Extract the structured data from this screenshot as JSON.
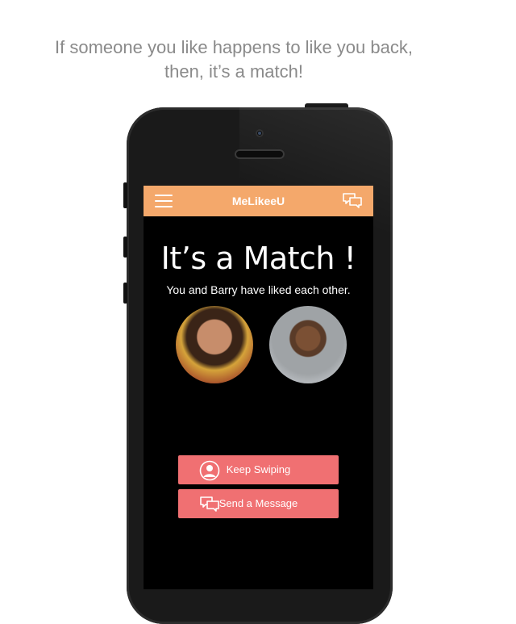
{
  "caption": {
    "line1": "If someone you like happens to like you back,",
    "line2": "then, it’s a match!"
  },
  "app": {
    "title": "MeLikeeU",
    "menu_icon": "hamburger-menu-icon",
    "chat_icon": "chat-bubbles-icon",
    "header_color": "#f4a86b"
  },
  "match": {
    "title": "It’s a Match !",
    "subtitle": "You and Barry have liked each other."
  },
  "actions": {
    "keep_swiping": "Keep Swiping",
    "send_message": "Send a Message",
    "button_color": "#f07072"
  }
}
